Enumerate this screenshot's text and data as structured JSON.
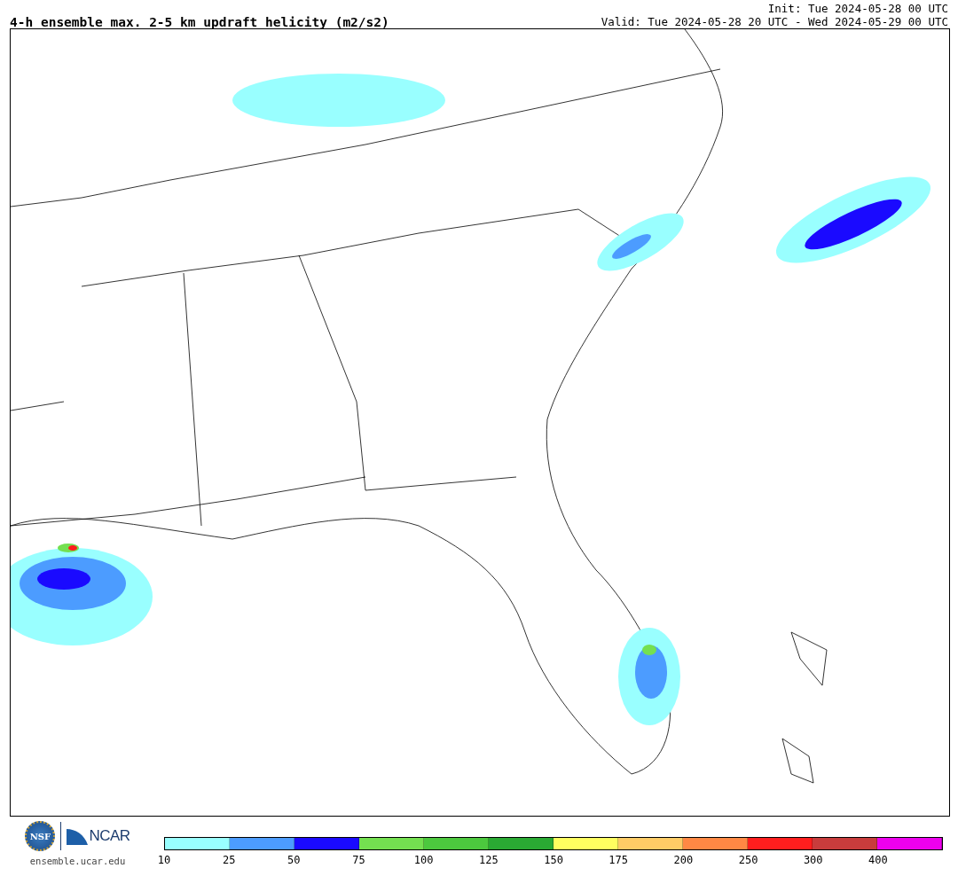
{
  "header": {
    "title": "4-h ensemble max. 2-5 km updraft helicity (m2/s2)",
    "init": "Init: Tue 2024-05-28 00 UTC",
    "valid": "Valid: Tue 2024-05-28 20 UTC - Wed 2024-05-29 00 UTC"
  },
  "footer": {
    "logos": [
      "NSF",
      "NCAR"
    ],
    "url": "ensemble.ucar.edu"
  },
  "colorbar": [
    {
      "label": "10",
      "color": "#99ffff"
    },
    {
      "label": "25",
      "color": "#4c9cff"
    },
    {
      "label": "50",
      "color": "#1a0aff"
    },
    {
      "label": "75",
      "color": "#74e050"
    },
    {
      "label": "100",
      "color": "#4cc83e"
    },
    {
      "label": "125",
      "color": "#2aaa33"
    },
    {
      "label": "150",
      "color": "#ffff60"
    },
    {
      "label": "175",
      "color": "#ffcc66"
    },
    {
      "label": "200",
      "color": "#ff8844"
    },
    {
      "label": "250",
      "color": "#ff1e1e"
    },
    {
      "label": "300",
      "color": "#c83c3c"
    },
    {
      "label": "400",
      "color": "#ee00ee"
    }
  ]
}
